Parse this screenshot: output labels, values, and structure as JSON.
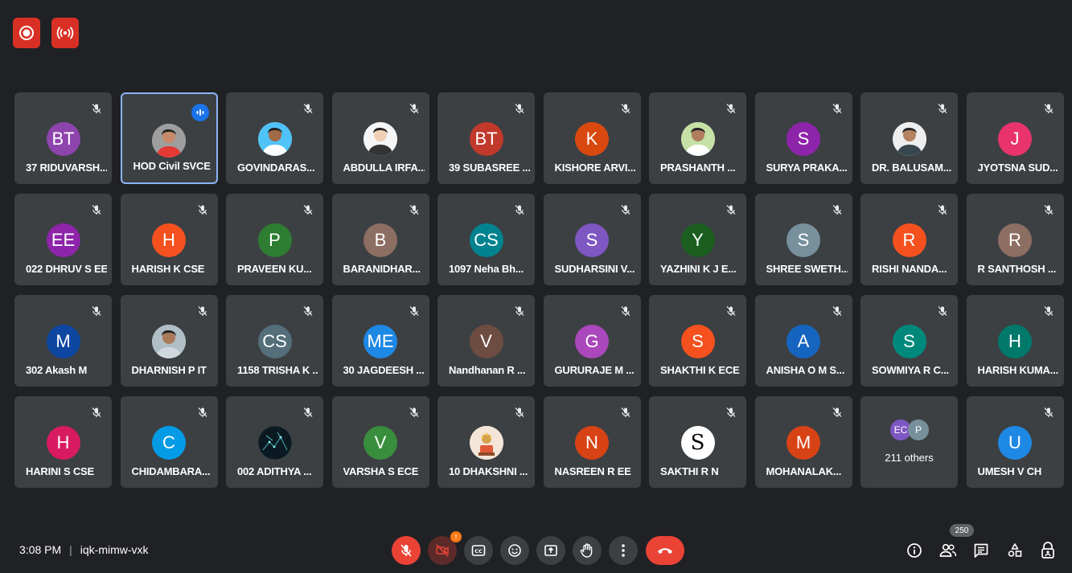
{
  "top_buttons": [
    {
      "name": "record-icon"
    },
    {
      "name": "live-stream-icon"
    }
  ],
  "tiles": [
    {
      "name": "37 RIDUVARSH...",
      "initials": "BT",
      "color": "#8e44ad",
      "muted": true
    },
    {
      "name": "HOD Civil SVCE",
      "initials": "",
      "photo": true,
      "speaking": true
    },
    {
      "name": "GOVINDARAS...",
      "initials": "",
      "photo": true,
      "muted": true
    },
    {
      "name": "ABDULLA IRFA...",
      "initials": "",
      "photo": true,
      "muted": true
    },
    {
      "name": "39 SUBASREE ...",
      "initials": "BT",
      "color": "#c0392b",
      "muted": true
    },
    {
      "name": "KISHORE ARVI...",
      "initials": "K",
      "color": "#d9480f",
      "muted": true
    },
    {
      "name": "PRASHANTH ...",
      "initials": "",
      "photo": true,
      "muted": true
    },
    {
      "name": "SURYA PRAKA...",
      "initials": "S",
      "color": "#8e24aa",
      "muted": true
    },
    {
      "name": "DR. BALUSAM...",
      "initials": "",
      "photo": true,
      "muted": true
    },
    {
      "name": "JYOTSNA SUD...",
      "initials": "J",
      "color": "#e8336d",
      "muted": true
    },
    {
      "name": "022 DHRUV S EE",
      "initials": "EE",
      "color": "#8e24aa",
      "muted": true
    },
    {
      "name": "HARISH K CSE",
      "initials": "H",
      "color": "#f4511e",
      "muted": true
    },
    {
      "name": "PRAVEEN KU...",
      "initials": "P",
      "color": "#2e7d32",
      "muted": true
    },
    {
      "name": "BARANIDHAR...",
      "initials": "B",
      "color": "#8d6e63",
      "muted": true
    },
    {
      "name": "1097 Neha Bh...",
      "initials": "CS",
      "color": "#00838f",
      "muted": true
    },
    {
      "name": "SUDHARSINI V...",
      "initials": "S",
      "color": "#7e57c2",
      "muted": true
    },
    {
      "name": "YAZHINI K J E...",
      "initials": "Y",
      "color": "#1b5e20",
      "muted": true
    },
    {
      "name": "SHREE SWETH...",
      "initials": "S",
      "color": "#78909c",
      "muted": true
    },
    {
      "name": "RISHI NANDA...",
      "initials": "R",
      "color": "#f4511e",
      "muted": true
    },
    {
      "name": "R SANTHOSH ...",
      "initials": "R",
      "color": "#8d6e63",
      "muted": true
    },
    {
      "name": "302 Akash M",
      "initials": "M",
      "color": "#0d47a1",
      "muted": true
    },
    {
      "name": "DHARNISH P IT",
      "initials": "",
      "photo": true,
      "muted": true
    },
    {
      "name": "1158 TRISHA K ...",
      "initials": "CS",
      "color": "#546e7a",
      "muted": true
    },
    {
      "name": "30 JAGDEESH ...",
      "initials": "ME",
      "color": "#1e88e5",
      "muted": true
    },
    {
      "name": "Nandhanan R ...",
      "initials": "V",
      "color": "#6d4c41",
      "muted": true
    },
    {
      "name": "GURURAJE M ...",
      "initials": "G",
      "color": "#ab47bc",
      "muted": true
    },
    {
      "name": "SHAKTHI K ECE",
      "initials": "S",
      "color": "#f4511e",
      "muted": true
    },
    {
      "name": "ANISHA O M S...",
      "initials": "A",
      "color": "#1565c0",
      "muted": true
    },
    {
      "name": "SOWMIYA R C...",
      "initials": "S",
      "color": "#00897b",
      "muted": true
    },
    {
      "name": "HARISH KUMA...",
      "initials": "H",
      "color": "#00796b",
      "muted": true
    },
    {
      "name": "HARINI S CSE",
      "initials": "H",
      "color": "#d81b60",
      "muted": true
    },
    {
      "name": "CHIDAMBARA...",
      "initials": "C",
      "color": "#039be5",
      "muted": true
    },
    {
      "name": "002 ADITHYA ...",
      "initials": "",
      "photo": true,
      "muted": true
    },
    {
      "name": "VARSHA S ECE",
      "initials": "V",
      "color": "#388e3c",
      "muted": true
    },
    {
      "name": "10 DHAKSHNI ...",
      "initials": "",
      "photo": true,
      "muted": true
    },
    {
      "name": "NASREEN R EE",
      "initials": "N",
      "color": "#d84315",
      "muted": true
    },
    {
      "name": "SAKTHI R N",
      "initials": "S",
      "color": "#ffffff",
      "text_color": "#000000",
      "muted": true
    },
    {
      "name": "MOHANALAK...",
      "initials": "M",
      "color": "#d84315",
      "muted": true
    },
    {
      "name": "",
      "others": true
    },
    {
      "name": "UMESH V CH",
      "initials": "U",
      "color": "#1e88e5",
      "muted": true
    }
  ],
  "others_tile": {
    "avatars": [
      {
        "initials": "EC",
        "color": "#7e57c2"
      },
      {
        "initials": "P",
        "color": "#78909c"
      }
    ],
    "label": "211 others"
  },
  "bottom": {
    "time": "3:08 PM",
    "separator": "|",
    "meeting_code": "iqk-mimw-vxk",
    "participant_count": "250",
    "camera_badge": "!"
  }
}
